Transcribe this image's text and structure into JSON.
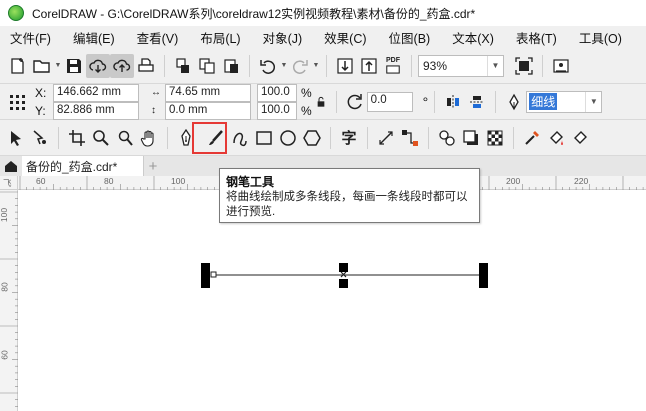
{
  "window": {
    "title": "CorelDRAW - G:\\CorelDRAW系列\\coreldraw12实例视频教程\\素材\\备份的_药盒.cdr*"
  },
  "menu": {
    "items": [
      "文件(F)",
      "编辑(E)",
      "查看(V)",
      "布局(L)",
      "对象(J)",
      "效果(C)",
      "位图(B)",
      "文本(X)",
      "表格(T)",
      "工具(O)"
    ]
  },
  "standard_toolbar": {
    "zoom_value": "93%",
    "pdf_label": "PDF"
  },
  "property_bar": {
    "x_label": "X:",
    "x_value": "146.662 mm",
    "y_label": "Y:",
    "y_value": "82.886 mm",
    "width_value": "74.65 mm",
    "height_value": "0.0 mm",
    "scale_w": "100.0",
    "scale_h": "100.0",
    "percent": "%",
    "rotation_value": "0.0",
    "degree": "°",
    "outline_width": "细线"
  },
  "toolbox": {
    "text_tool_glyph": "字"
  },
  "document": {
    "tab_label": "备份的_药盒.cdr*",
    "add_tab": "+"
  },
  "ruler": {
    "h_labels": [
      "60",
      "80",
      "100",
      "120",
      "140",
      "160",
      "180",
      "200",
      "220"
    ],
    "v_labels": [
      "100",
      "80",
      "60"
    ],
    "corner_label": "飞"
  },
  "tooltip": {
    "title": "钢笔工具",
    "description": "将曲线绘制成多条线段，每画一条线段时都可以进行预览."
  },
  "colors": {
    "highlight": "#e53935",
    "selection": "#3478d8"
  }
}
